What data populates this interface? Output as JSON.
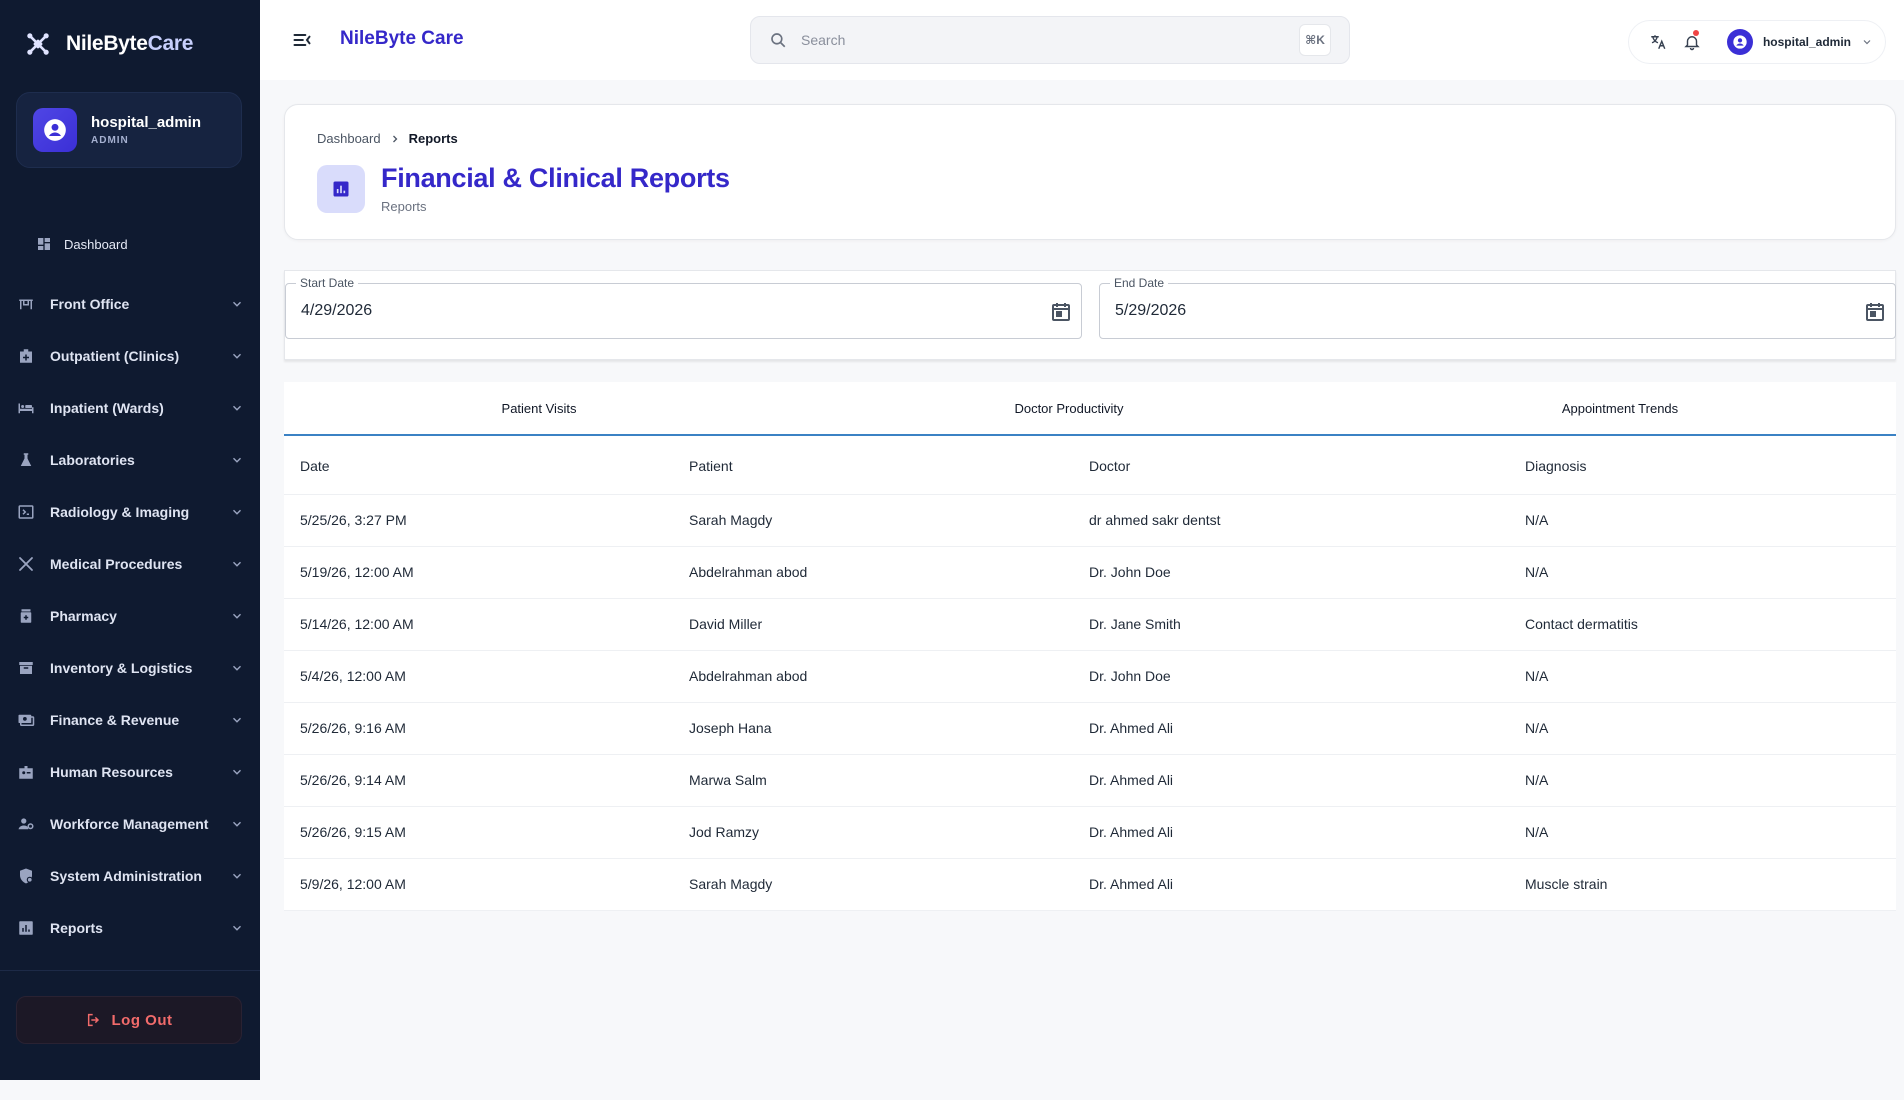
{
  "brand": {
    "name_part1": "NileByte",
    "name_part2": "Care"
  },
  "user": {
    "name": "hospital_admin",
    "role": "ADMIN"
  },
  "nav": {
    "dashboard": "Dashboard",
    "items": [
      {
        "label": "Front Office",
        "icon": "reception-desk-icon"
      },
      {
        "label": "Outpatient (Clinics)",
        "icon": "medical-bag-icon"
      },
      {
        "label": "Inpatient (Wards)",
        "icon": "bed-icon"
      },
      {
        "label": "Laboratories",
        "icon": "flask-icon"
      },
      {
        "label": "Radiology & Imaging",
        "icon": "scan-icon"
      },
      {
        "label": "Medical Procedures",
        "icon": "tools-icon"
      },
      {
        "label": "Pharmacy",
        "icon": "medicine-bottle-icon"
      },
      {
        "label": "Inventory & Logistics",
        "icon": "archive-box-icon"
      },
      {
        "label": "Finance & Revenue",
        "icon": "payments-icon"
      },
      {
        "label": "Human Resources",
        "icon": "badge-icon"
      },
      {
        "label": "Workforce Management",
        "icon": "people-settings-icon"
      },
      {
        "label": "System Administration",
        "icon": "admin-shield-icon"
      },
      {
        "label": "Reports",
        "icon": "report-chart-icon"
      }
    ]
  },
  "logout": "Log Out",
  "topbar": {
    "title": "NileByte Care",
    "search_placeholder": "Search",
    "shortcut": "⌘K",
    "account_name": "hospital_admin"
  },
  "header": {
    "breadcrumb": {
      "home": "Dashboard",
      "current": "Reports"
    },
    "title": "Financial & Clinical Reports",
    "subtitle": "Reports"
  },
  "filters": {
    "start_label": "Start Date",
    "start_value": "4/29/2026",
    "end_label": "End Date",
    "end_value": "5/29/2026"
  },
  "tabs": [
    "Patient Visits",
    "Doctor Productivity",
    "Appointment Trends"
  ],
  "table": {
    "columns": [
      "Date",
      "Patient",
      "Doctor",
      "Diagnosis"
    ],
    "rows": [
      [
        "5/25/26, 3:27 PM",
        "Sarah Magdy",
        "dr ahmed sakr dentst",
        "N/A"
      ],
      [
        "5/19/26, 12:00 AM",
        "Abdelrahman abod",
        "Dr. John Doe",
        "N/A"
      ],
      [
        "5/14/26, 12:00 AM",
        "David Miller",
        "Dr. Jane Smith",
        "Contact dermatitis"
      ],
      [
        "5/4/26, 12:00 AM",
        "Abdelrahman abod",
        "Dr. John Doe",
        "N/A"
      ],
      [
        "5/26/26, 9:16 AM",
        "Joseph Hana",
        "Dr. Ahmed Ali",
        "N/A"
      ],
      [
        "5/26/26, 9:14 AM",
        "Marwa Salm",
        "Dr. Ahmed Ali",
        "N/A"
      ],
      [
        "5/26/26, 9:15 AM",
        "Jod Ramzy",
        "Dr. Ahmed Ali",
        "N/A"
      ],
      [
        "5/9/26, 12:00 AM",
        "Sarah Magdy",
        "Dr. Ahmed Ali",
        "Muscle strain"
      ]
    ]
  },
  "colors": {
    "sidebar_bg": "#0f1a30",
    "accent": "#3528c9",
    "danger": "#f26b6b",
    "tab_underline": "#3b82c4"
  }
}
